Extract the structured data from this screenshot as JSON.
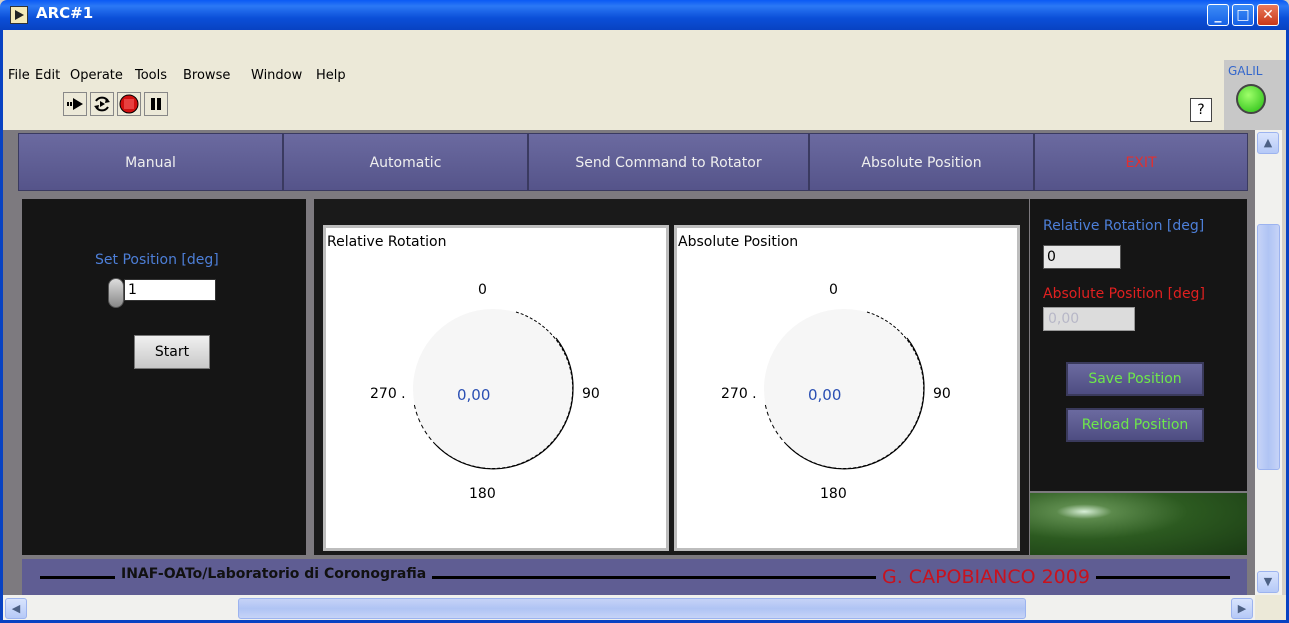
{
  "window": {
    "title": "ARC#1"
  },
  "menu": [
    "File",
    "Edit",
    "Operate",
    "Tools",
    "Browse",
    "Window",
    "Help"
  ],
  "toolbar": {
    "icons": [
      "run-arrow-icon",
      "run-continuously-icon",
      "abort-icon",
      "pause-icon"
    ],
    "help_icon": "?"
  },
  "galil": {
    "label": "GALIL",
    "led_color": "#22bb11"
  },
  "tabs": [
    "Manual",
    "Automatic",
    "Send Command to Rotator",
    "Absolute Position",
    "EXIT"
  ],
  "manual": {
    "set_position_label": "Set Position [deg]",
    "set_position_value": "1",
    "start_label": "Start"
  },
  "dials": [
    {
      "title": "Relative Rotation",
      "value": "0,00",
      "ticks": [
        "0",
        "90",
        "180",
        "270 ."
      ]
    },
    {
      "title": "Absolute Position",
      "value": "0,00",
      "ticks": [
        "0",
        "90",
        "180",
        "270 ."
      ]
    }
  ],
  "readouts": {
    "relative_label": "Relative Rotation [deg]",
    "relative_value": "0",
    "absolute_label": "Absolute Position [deg]",
    "absolute_value": "0,00",
    "save_label": "Save Position",
    "reload_label": "Reload Position"
  },
  "footer": {
    "left": "INAF-OATo/Laboratorio di Coronografia",
    "right": "G. CAPOBIANCO 2009"
  },
  "colors": {
    "tab_bg": "#5f5e94",
    "exit_text": "#e23030",
    "blue_label": "#4d7fd8",
    "red_label": "#e02020",
    "green_text": "#6ee84a",
    "footer_red": "#c8121e"
  }
}
